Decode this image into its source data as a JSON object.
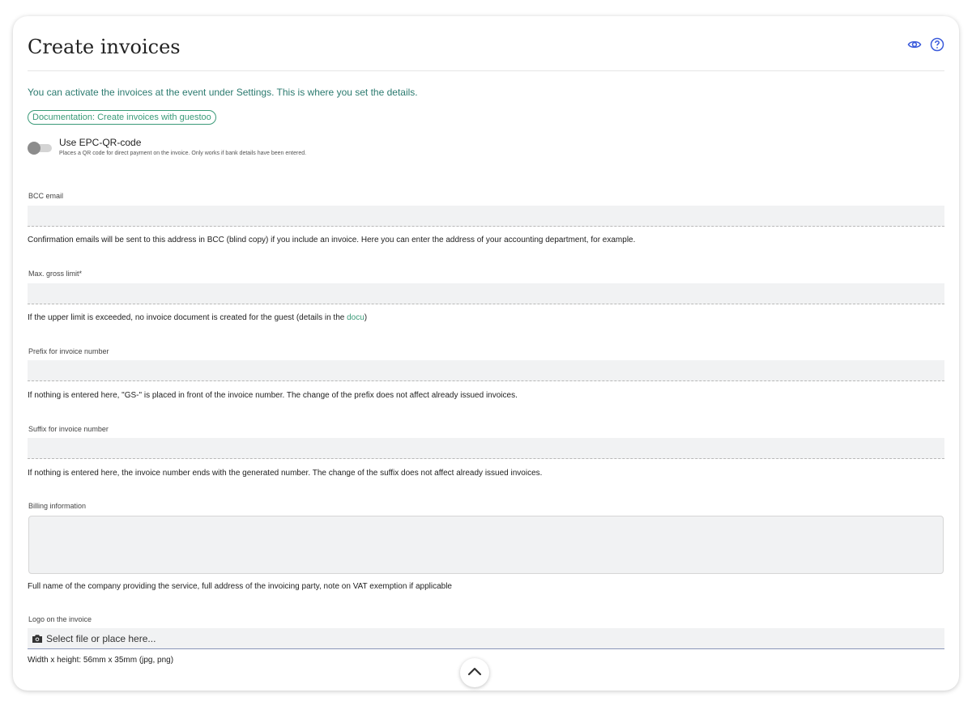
{
  "page": {
    "title": "Create invoices",
    "intro": "You can activate the invoices at the event under Settings. This is where you set the details.",
    "doc_link": "Documentation: Create invoices with guestoo",
    "icons": {
      "preview": "eye-icon",
      "help": "help-circle-icon",
      "collapse": "chevron-up-icon",
      "camera": "camera-icon"
    },
    "colors": {
      "accent": "#3a9a78",
      "icon": "#3b5bdb",
      "intro_text": "#2b7a6f"
    }
  },
  "epc": {
    "label": "Use EPC-QR-code",
    "hint": "Places a QR code for direct payment on the invoice. Only works if bank details have been entered.",
    "enabled": false
  },
  "fields": {
    "bcc": {
      "label": "BCC email",
      "value": "",
      "help": "Confirmation emails will be sent to this address in BCC (blind copy) if you include an invoice. Here you can enter the address of your accounting department, for example."
    },
    "gross": {
      "label": "Max. gross limit*",
      "value": "",
      "help_before": "If the upper limit is exceeded, no invoice document is created for the guest (details in the ",
      "help_link": "docu",
      "help_after": ")"
    },
    "prefix": {
      "label": "Prefix for invoice number",
      "value": "",
      "help": "If nothing is entered here, \"GS-\" is placed in front of the invoice number. The change of the prefix does not affect already issued invoices."
    },
    "suffix": {
      "label": "Suffix for invoice number",
      "value": "",
      "help": "If nothing is entered here, the invoice number ends with the generated number. The change of the suffix does not affect already issued invoices."
    },
    "billing": {
      "label": "Billing information",
      "value": "",
      "help": "Full name of the company providing the service, full address of the invoicing party, note on VAT exemption if applicable"
    },
    "logo": {
      "label": "Logo on the invoice",
      "placeholder": "Select file or place here...",
      "help": "Width x height: 56mm x 35mm (jpg, png)"
    }
  }
}
